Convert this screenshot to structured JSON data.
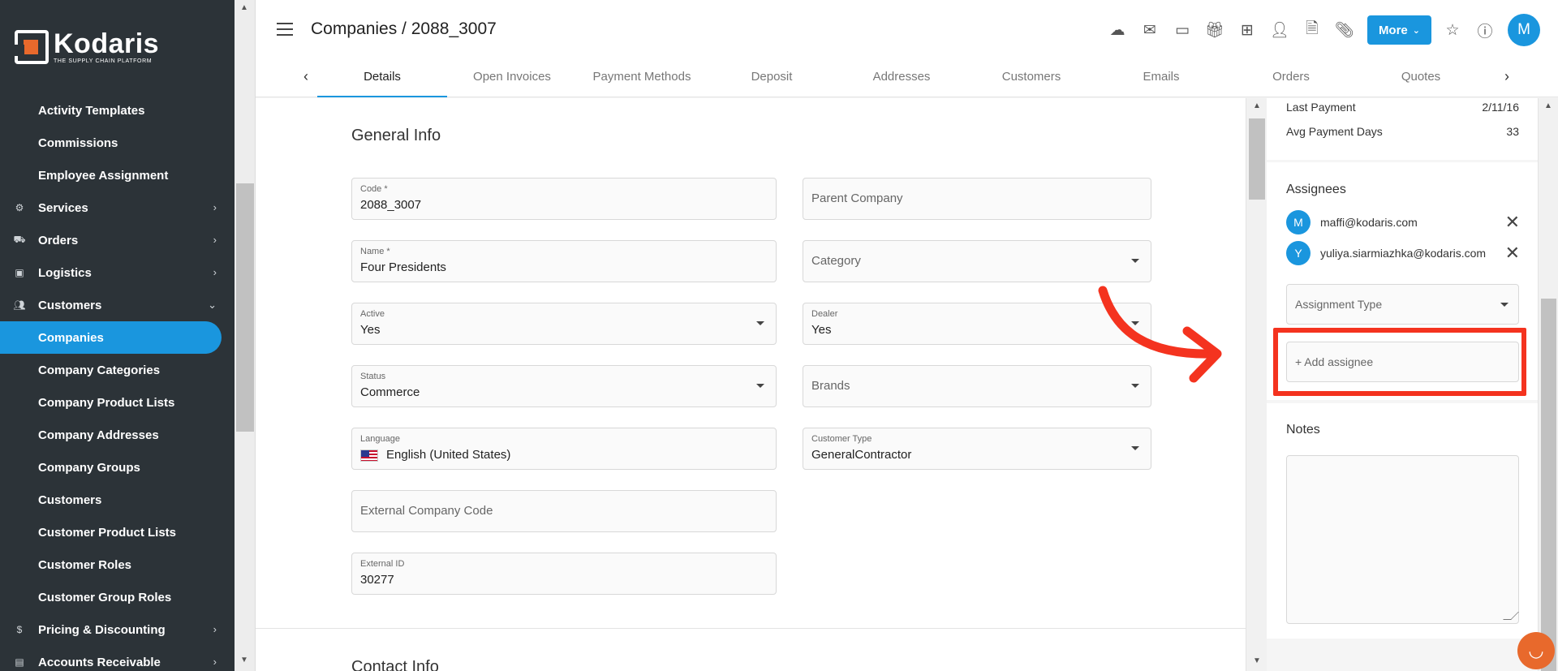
{
  "brand": {
    "name": "Kodaris",
    "tagline": "THE SUPPLY CHAIN PLATFORM"
  },
  "sidebar": {
    "items": [
      {
        "label": "Activity Templates",
        "type": "sub"
      },
      {
        "label": "Commissions",
        "type": "sub"
      },
      {
        "label": "Employee Assignment",
        "type": "sub"
      },
      {
        "label": "Services",
        "type": "top",
        "icon": "gears-icon",
        "chevron": "›"
      },
      {
        "label": "Orders",
        "type": "top",
        "icon": "truck-icon",
        "chevron": "›"
      },
      {
        "label": "Logistics",
        "type": "top",
        "icon": "shipping-icon",
        "chevron": "›"
      },
      {
        "label": "Customers",
        "type": "top",
        "icon": "people-icon",
        "chevron": "⌄"
      },
      {
        "label": "Companies",
        "type": "sub",
        "active": true
      },
      {
        "label": "Company Categories",
        "type": "sub"
      },
      {
        "label": "Company Product Lists",
        "type": "sub"
      },
      {
        "label": "Company Addresses",
        "type": "sub"
      },
      {
        "label": "Company Groups",
        "type": "sub"
      },
      {
        "label": "Customers",
        "type": "sub"
      },
      {
        "label": "Customer Product Lists",
        "type": "sub"
      },
      {
        "label": "Customer Roles",
        "type": "sub"
      },
      {
        "label": "Customer Group Roles",
        "type": "sub"
      },
      {
        "label": "Pricing & Discounting",
        "type": "top",
        "icon": "dollar-icon",
        "chevron": "›"
      },
      {
        "label": "Accounts Receivable",
        "type": "top",
        "icon": "receivable-icon",
        "chevron": "›"
      }
    ]
  },
  "header": {
    "title": "Companies / 2088_3007",
    "more_label": "More",
    "avatar_initial": "M",
    "toolbar_icons": [
      "cloud-upload-icon",
      "mail-icon",
      "payment-icon",
      "gift-icon",
      "add-screen-icon",
      "add-person-icon",
      "add-document-icon",
      "attachment-icon"
    ]
  },
  "tabs": [
    "Details",
    "Open Invoices",
    "Payment Methods",
    "Deposit",
    "Addresses",
    "Customers",
    "Emails",
    "Orders",
    "Quotes"
  ],
  "general": {
    "title": "General Info",
    "code_label": "Code *",
    "code_value": "2088_3007",
    "parent_company_placeholder": "Parent Company",
    "name_label": "Name *",
    "name_value": "Four Presidents",
    "category_placeholder": "Category",
    "active_label": "Active",
    "active_value": "Yes",
    "dealer_label": "Dealer",
    "dealer_value": "Yes",
    "status_label": "Status",
    "status_value": "Commerce",
    "brands_placeholder": "Brands",
    "language_label": "Language",
    "language_value": "English (United States)",
    "customer_type_label": "Customer Type",
    "customer_type_value": "GeneralContractor",
    "external_code_placeholder": "External Company Code",
    "external_id_label": "External ID",
    "external_id_value": "30277"
  },
  "contact": {
    "title": "Contact Info"
  },
  "right": {
    "last_payment_label": "Last Payment",
    "last_payment_value": "2/11/16",
    "avg_days_label": "Avg Payment Days",
    "avg_days_value": "33",
    "assignees_title": "Assignees",
    "assignees": [
      {
        "initial": "M",
        "email": "maffi@kodaris.com"
      },
      {
        "initial": "Y",
        "email": "yuliya.siarmiazhka@kodaris.com"
      }
    ],
    "assignment_type_placeholder": "Assignment Type",
    "add_assignee_placeholder": "+ Add assignee",
    "notes_title": "Notes"
  },
  "colors": {
    "accent": "#1a96de",
    "sidebar": "#2c3338",
    "highlight": "#f4331f",
    "brand_orange": "#e8692c"
  }
}
